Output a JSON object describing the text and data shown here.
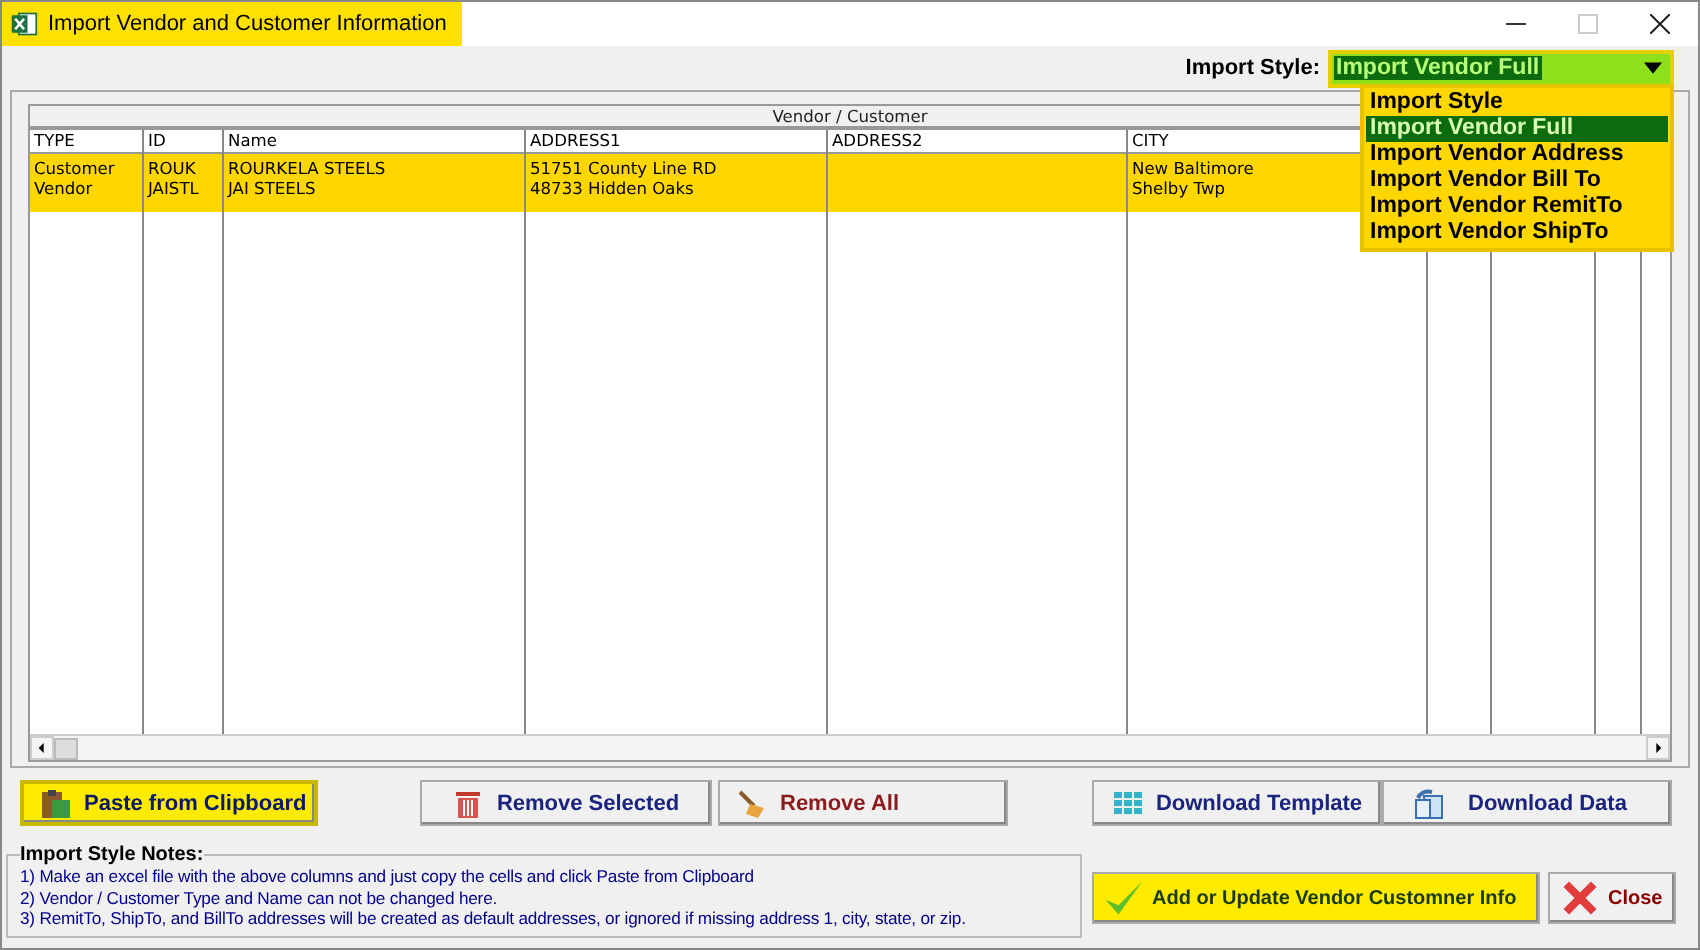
{
  "window": {
    "title": "Import Vendor and Customer Information",
    "highlighted": true
  },
  "import_style": {
    "label": "Import Style:",
    "value": "Import Vendor Full",
    "expanded": true,
    "options": [
      {
        "label": "Import Style",
        "selected": false
      },
      {
        "label": "Import Vendor Full",
        "selected": true
      },
      {
        "label": "Import Vendor Address",
        "selected": false
      },
      {
        "label": "Import Vendor Bill To",
        "selected": false
      },
      {
        "label": "Import Vendor RemitTo",
        "selected": false
      },
      {
        "label": "Import Vendor ShipTo",
        "selected": false
      }
    ]
  },
  "grid": {
    "group_header": "Vendor / Customer",
    "columns": [
      "TYPE",
      "ID",
      "Name",
      "ADDRESS1",
      "ADDRESS2",
      "CITY"
    ],
    "rows": [
      {
        "cells": [
          "Customer",
          "ROUK",
          "ROURKELA STEELS",
          "51751 County Line RD",
          "",
          "New Baltimore"
        ],
        "selected": true
      },
      {
        "cells": [
          "Vendor",
          "JAISTL",
          "JAI STEELS",
          "48733 Hidden Oaks",
          "",
          "Shelby Twp"
        ],
        "selected": true
      }
    ]
  },
  "buttons": [
    {
      "label": "Paste from Clipboard",
      "kind": "paste",
      "highlighted": true
    },
    {
      "label": "Remove Selected",
      "kind": "remove",
      "highlighted": false
    },
    {
      "label": "Remove All",
      "kind": "remove_all",
      "highlighted": false
    },
    {
      "label": "Download Template",
      "kind": "template",
      "highlighted": false
    },
    {
      "label": "Download Data",
      "kind": "data",
      "highlighted": false
    }
  ],
  "notes": {
    "title": "Import Style Notes:",
    "lines": [
      "1) Make an excel file with the above columns and just copy the cells and click Paste from Clipboard",
      "2) Vendor / Customer Type and Name can not be changed here.",
      "3) RemitTo, ShipTo, and BillTo addresses will be created as default addresses, or ignored if missing address 1, city, state, or zip."
    ]
  },
  "actions": [
    {
      "label": "Add or Update Vendor Customner Info",
      "kind": "confirm",
      "highlighted": true
    },
    {
      "label": "Close",
      "kind": "close",
      "highlighted": false
    }
  ]
}
